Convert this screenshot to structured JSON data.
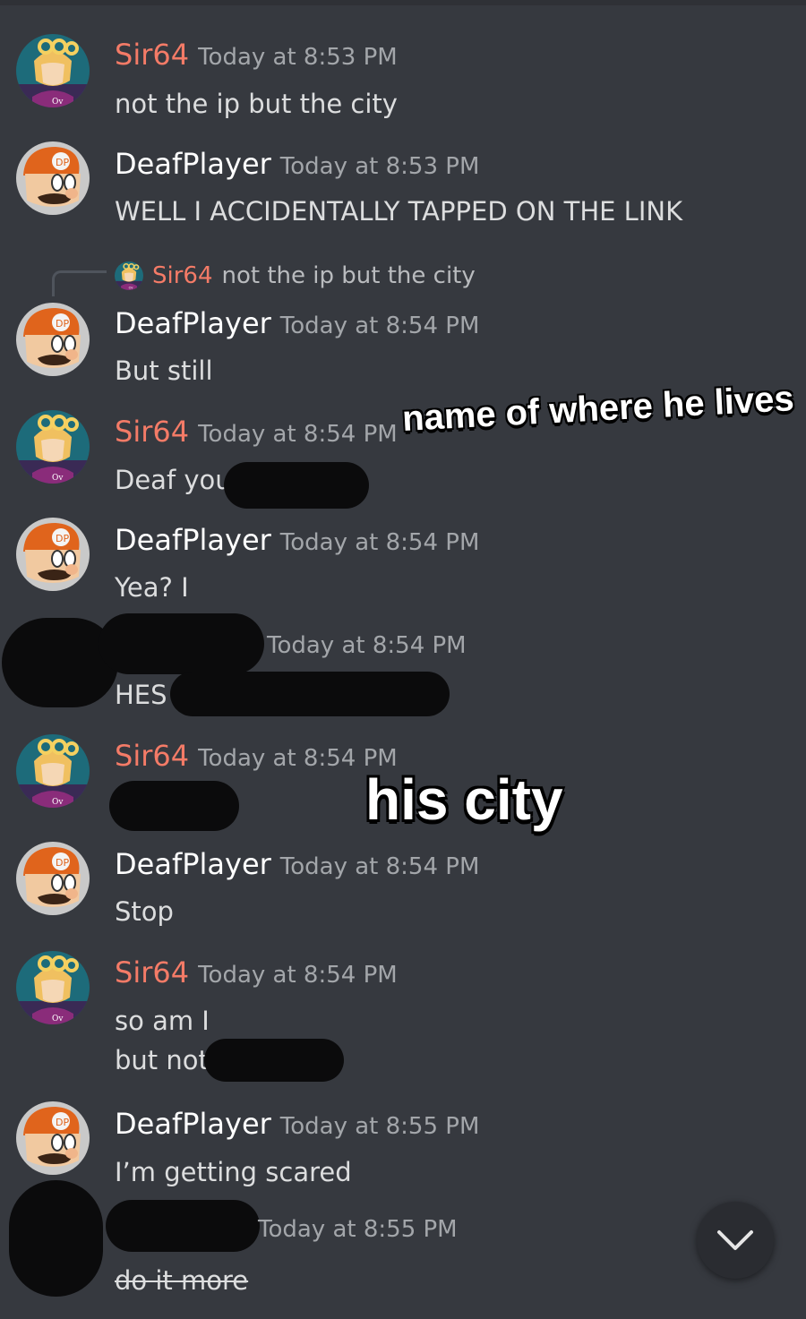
{
  "colors": {
    "background": "#36393f",
    "sir_name": "#f47b67",
    "deaf_name": "#ffffff",
    "timestamp": "#a3a6aa",
    "text": "#dcddde"
  },
  "messages": [
    {
      "author": "Sir64",
      "time": "Today at 8:53 PM",
      "lines": [
        "not the ip but the city"
      ]
    },
    {
      "author": "DeafPlayer",
      "time": "Today at 8:53 PM",
      "lines": [
        "WELL I ACCIDENTALLY TAPPED ON THE LINK"
      ]
    },
    {
      "author": "DeafPlayer",
      "time": "Today at 8:54 PM",
      "lines": [
        "But still"
      ],
      "reply": {
        "author": "Sir64",
        "text": "not the ip but the city"
      }
    },
    {
      "author": "Sir64",
      "time": "Today at 8:54 PM",
      "lines": [
        "Deaf you"
      ]
    },
    {
      "author": "DeafPlayer",
      "time": "Today at 8:54 PM",
      "lines": [
        "Yea? I"
      ]
    },
    {
      "author": "",
      "time": "Today at 8:54 PM",
      "lines": [
        "HES"
      ]
    },
    {
      "author": "Sir64",
      "time": "Today at 8:54 PM",
      "lines": [
        ""
      ]
    },
    {
      "author": "DeafPlayer",
      "time": "Today at 8:54 PM",
      "lines": [
        "Stop"
      ]
    },
    {
      "author": "Sir64",
      "time": "Today at 8:54 PM",
      "lines": [
        "so am I",
        "but not"
      ]
    },
    {
      "author": "DeafPlayer",
      "time": "Today at 8:55 PM",
      "lines": [
        "I’m getting scared"
      ]
    },
    {
      "author": "",
      "time": "Today at 8:55 PM",
      "lines": [
        "do it more"
      ]
    }
  ],
  "overlays": {
    "caption_1": "name of where he lives",
    "caption_2": "his city"
  },
  "jump_button": {
    "icon": "chevron-down-icon"
  }
}
